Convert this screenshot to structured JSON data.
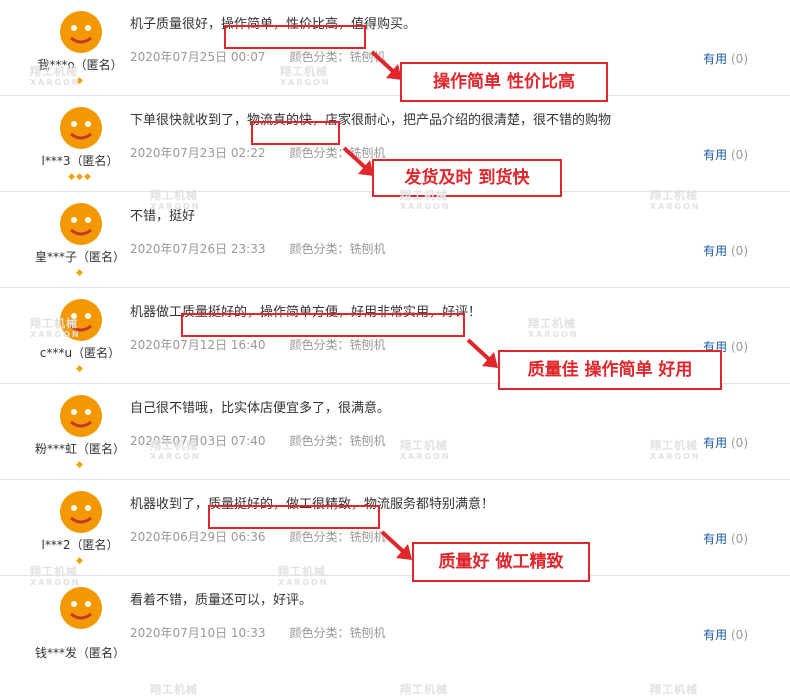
{
  "reviews": [
    {
      "user": "我***o（匿名）",
      "level": "◆",
      "content": "机子质量很好，操作简单，性价比高，值得购买。",
      "date": "2020年07月25日 00:07",
      "color": "颜色分类：铣刨机",
      "helpful": "有用",
      "helpful_count": "(0)",
      "callout": "操作简单 性价比高"
    },
    {
      "user": "l***3（匿名）",
      "level": "◆◆◆",
      "content": "下单很快就收到了，物流真的快，店家很耐心，把产品介绍的很清楚，很不错的购物",
      "date": "2020年07月23日 02:22",
      "color": "颜色分类：铣刨机",
      "helpful": "有用",
      "helpful_count": "(0)",
      "callout": "发货及时 到货快"
    },
    {
      "user": "皇***子（匿名）",
      "level": "◆",
      "content": "不错，挺好",
      "date": "2020年07月26日 23:33",
      "color": "颜色分类：铣刨机",
      "helpful": "有用",
      "helpful_count": "(0)",
      "callout": ""
    },
    {
      "user": "c***u（匿名）",
      "level": "◆",
      "content": "机器做工质量挺好的，操作简单方便，好用非常实用，好评！",
      "date": "2020年07月12日 16:40",
      "color": "颜色分类：铣刨机",
      "helpful": "有用",
      "helpful_count": "(0)",
      "callout": "质量佳 操作简单 好用"
    },
    {
      "user": "粉***虹（匿名）",
      "level": "◆",
      "content": "自己很不错哦，比实体店便宜多了，很满意。",
      "date": "2020年07月03日 07:40",
      "color": "颜色分类：铣刨机",
      "helpful": "有用",
      "helpful_count": "(0)",
      "callout": ""
    },
    {
      "user": "l***2（匿名）",
      "level": "◆",
      "content": "机器收到了，质量挺好的，做工很精致，物流服务都特别满意！",
      "date": "2020年06月29日 06:36",
      "color": "颜色分类：铣刨机",
      "helpful": "有用",
      "helpful_count": "(0)",
      "callout": "质量好 做工精致"
    },
    {
      "user": "钱***发（匿名）",
      "level": "",
      "content": "看着不错，质量还可以，好评。",
      "date": "2020年07月10日 10:33",
      "color": "颜色分类：铣刨机",
      "helpful": "有用",
      "helpful_count": "(0)",
      "callout": ""
    }
  ],
  "watermark": {
    "cn": "翔工机械",
    "en": "XARGON"
  },
  "colors": {
    "highlight": "#e0262b",
    "link": "#1f5ca8",
    "meta": "#999999",
    "avatar": "#f39800"
  }
}
